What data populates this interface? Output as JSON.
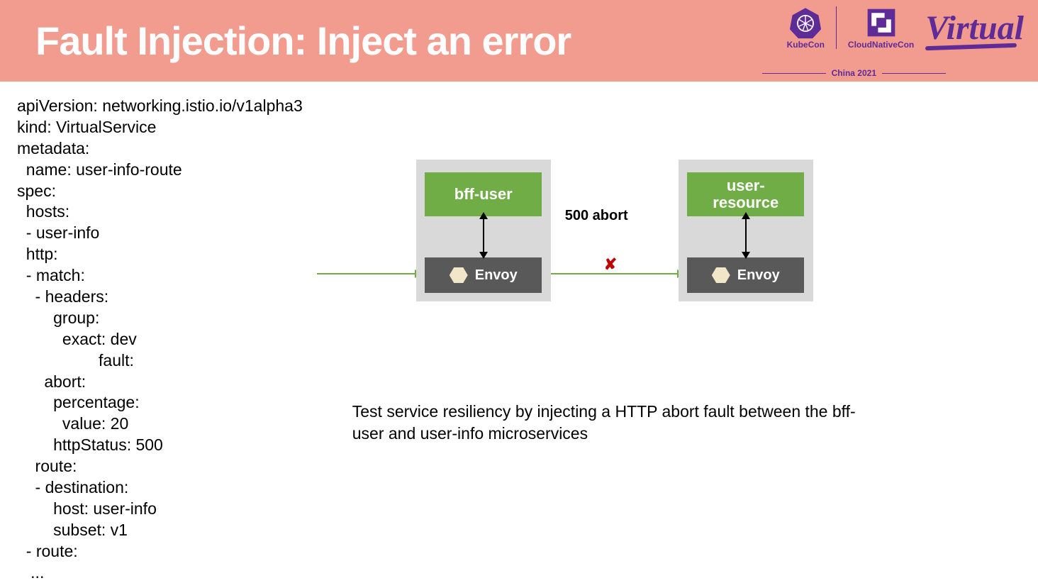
{
  "header": {
    "title": "Fault Injection: Inject an error",
    "logos": {
      "kubecon": "KubeCon",
      "cloudnativecon": "CloudNativeCon",
      "china": "China 2021",
      "virtual": "Virtual"
    }
  },
  "yaml": "apiVersion: networking.istio.io/v1alpha3\nkind: VirtualService\nmetadata:\n  name: user-info-route\nspec:\n  hosts:\n  - user-info\n  http:\n  - match:\n    - headers:\n        group:\n          exact: dev\n                  fault:\n      abort:\n        percentage:\n          value: 20\n        httpStatus: 500\n    route:\n    - destination:\n        host: user-info\n        subset: v1\n  - route:\n   ...",
  "diagram": {
    "left_service": "bff-user",
    "right_service": "user-\nresource",
    "envoy": "Envoy",
    "abort_label": "500 abort"
  },
  "description": "Test service resiliency by injecting a HTTP abort fault between the bff-user and user-info microservices"
}
